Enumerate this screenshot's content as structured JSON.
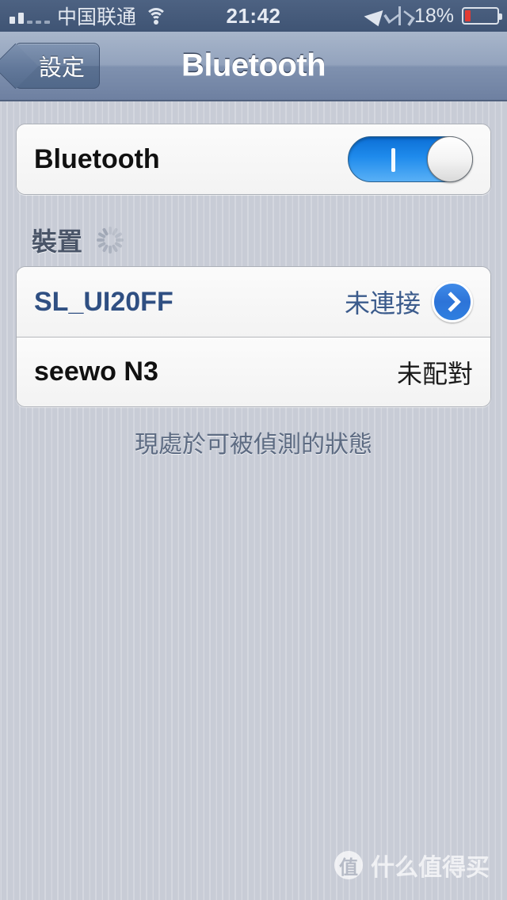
{
  "status_bar": {
    "signal_bars_filled": 2,
    "signal_bars_empty": 3,
    "carrier": "中国联通",
    "wifi_icon": "wifi-icon",
    "time": "21:42",
    "location_icon": "location-arrow-icon",
    "bluetooth_icon": "bluetooth-icon",
    "battery_percent": "18%",
    "battery_level": 18,
    "battery_color": "#e23b34"
  },
  "nav_bar": {
    "back_label": "設定",
    "title": "Bluetooth"
  },
  "bluetooth_toggle": {
    "label": "Bluetooth",
    "state": "on",
    "on_mark": "I",
    "accent_color": "#1f8bec"
  },
  "devices_section": {
    "header": "裝置",
    "spinner_icon": "activity-spinner-icon",
    "rows": [
      {
        "name": "SL_UI20FF",
        "status": "未連接",
        "has_disclosure": true,
        "disclosure_icon": "chevron-right-circle-icon",
        "name_color": "#2f4f82",
        "status_color": "#3b5b8c"
      },
      {
        "name": "seewo N3",
        "status": "未配對",
        "has_disclosure": false,
        "name_color": "#111111",
        "status_color": "#1a1a1a"
      }
    ],
    "footer_note": "現處於可被偵測的狀態"
  },
  "watermark": {
    "badge": "值",
    "text": "什么值得买"
  }
}
